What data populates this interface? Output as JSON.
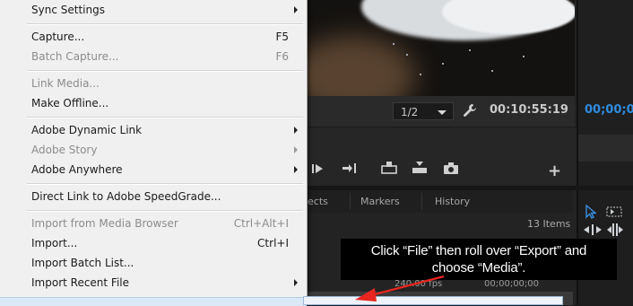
{
  "menu": {
    "items": [
      {
        "label": "Sync Settings",
        "shortcut": "",
        "submenu": true,
        "disabled": false
      },
      {
        "label": "Capture...",
        "shortcut": "F5",
        "submenu": false,
        "disabled": false
      },
      {
        "label": "Batch Capture...",
        "shortcut": "F6",
        "submenu": false,
        "disabled": true
      },
      {
        "label": "Link Media...",
        "shortcut": "",
        "submenu": false,
        "disabled": true
      },
      {
        "label": "Make Offline...",
        "shortcut": "",
        "submenu": false,
        "disabled": false
      },
      {
        "label": "Adobe Dynamic Link",
        "shortcut": "",
        "submenu": true,
        "disabled": false
      },
      {
        "label": "Adobe Story",
        "shortcut": "",
        "submenu": true,
        "disabled": true
      },
      {
        "label": "Adobe Anywhere",
        "shortcut": "",
        "submenu": true,
        "disabled": false
      },
      {
        "label": "Direct Link to Adobe SpeedGrade...",
        "shortcut": "",
        "submenu": false,
        "disabled": false
      },
      {
        "label": "Import from Media Browser",
        "shortcut": "Ctrl+Alt+I",
        "submenu": false,
        "disabled": true
      },
      {
        "label": "Import...",
        "shortcut": "Ctrl+I",
        "submenu": false,
        "disabled": false
      },
      {
        "label": "Import Batch List...",
        "shortcut": "",
        "submenu": false,
        "disabled": false
      },
      {
        "label": "Import Recent File",
        "shortcut": "",
        "submenu": true,
        "disabled": false
      }
    ]
  },
  "monitor": {
    "zoom": "1/2",
    "timecode": "00:10:55:19",
    "right_timecode": "00;00;0"
  },
  "panel": {
    "tabs": [
      "ects",
      "Markers",
      "History"
    ],
    "items_count": "13 Items",
    "fps": "240.00 fps",
    "timecode": "00;00;00;00"
  },
  "annotation": {
    "line1": "Click “File” then roll over “Export” and",
    "line2": "choose “Media”."
  },
  "colors": {
    "menu_bg": "#f0f0f0",
    "timecode_blue": "#2f8ce0",
    "arrow_red": "#e8251f"
  }
}
